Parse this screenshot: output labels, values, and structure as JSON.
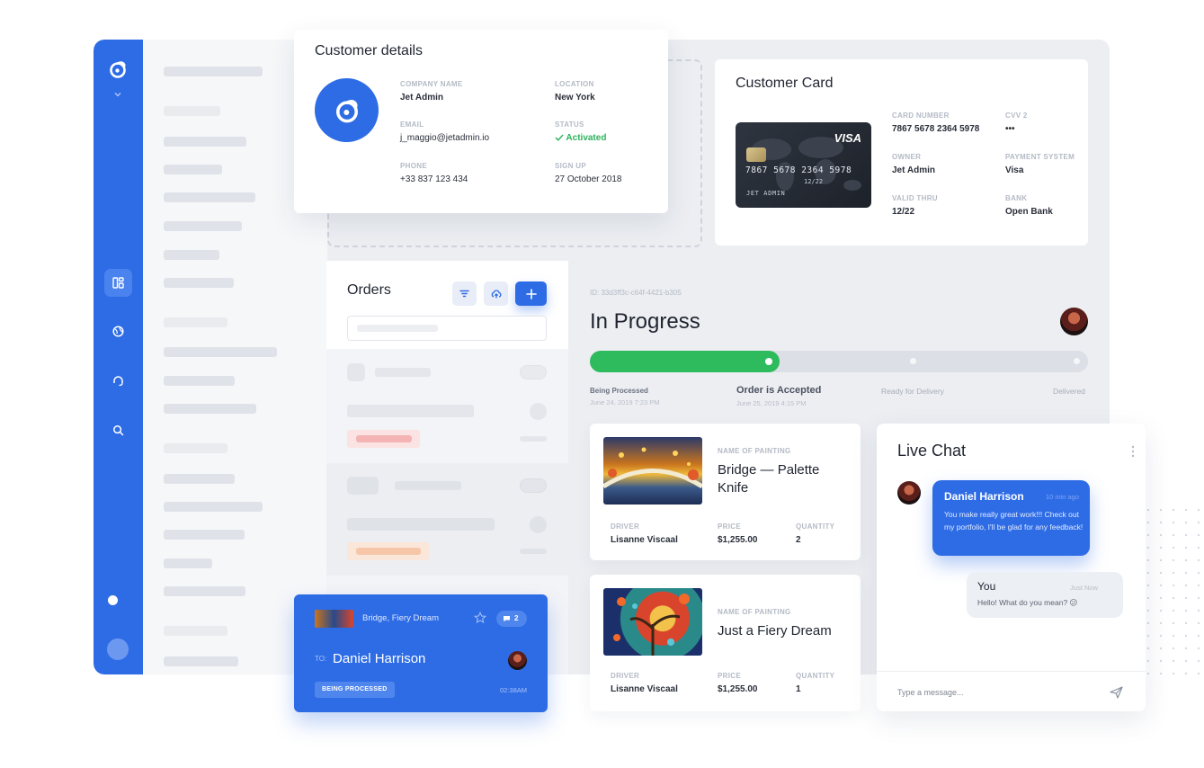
{
  "customer_details": {
    "title": "Customer details",
    "company_label": "COMPANY NAME",
    "company": "Jet Admin",
    "location_label": "LOCATION",
    "location": "New York",
    "email_label": "EMAIL",
    "email": "j_maggio@jetadmin.io",
    "status_label": "STATUS",
    "status": "Activated",
    "phone_label": "PHONE",
    "phone": "+33 837 123 434",
    "signup_label": "SIGN UP",
    "signup": "27 October 2018"
  },
  "customer_card": {
    "title": "Customer Card",
    "card_brand": "VISA",
    "card_face_number": "7867 5678 2364 5978",
    "card_face_expiry": "12/22",
    "card_face_holder": "JET ADMIN",
    "number_label": "CARD NUMBER",
    "number": "7867 5678 2364 5978",
    "cvv_label": "CVV 2",
    "cvv": "•••",
    "owner_label": "OWNER",
    "owner": "Jet Admin",
    "system_label": "PAYMENT SYSTEM",
    "system": "Visa",
    "valid_label": "VALID THRU",
    "valid": "12/22",
    "bank_label": "BANK",
    "bank": "Open Bank"
  },
  "orders": {
    "title": "Orders"
  },
  "progress": {
    "order_id": "ID: 33d3ff3c-c64f-4421-b305",
    "title": "In Progress",
    "fraction": 0.38,
    "steps": [
      {
        "label": "Being Processed",
        "date": "June 24, 2019 7:23 PM"
      },
      {
        "label": "Order is Accepted",
        "date": "June 25, 2019 4:15 PM"
      },
      {
        "label": "Ready for Delivery",
        "date": ""
      },
      {
        "label": "Delivered",
        "date": ""
      }
    ]
  },
  "paintings": [
    {
      "name_label": "NAME OF PAINTING",
      "name": "Bridge — Palette Knife",
      "driver_label": "DRIVER",
      "driver": "Lisanne Viscaal",
      "price_label": "PRICE",
      "price": "$1,255.00",
      "qty_label": "QUANTITY",
      "qty": "2"
    },
    {
      "name_label": "NAME OF PAINTING",
      "name": "Just a Fiery Dream",
      "driver_label": "DRIVER",
      "driver": "Lisanne Viscaal",
      "price_label": "PRICE",
      "price": "$1,255.00",
      "qty_label": "QUANTITY",
      "qty": "1"
    }
  ],
  "chat": {
    "title": "Live Chat",
    "incoming": {
      "name": "Daniel Harrison",
      "time": "10 min ago",
      "text": "You make really great work!!! Check out my portfolio, I'll be glad for any feedback!"
    },
    "outgoing": {
      "name": "You",
      "time": "Just Now",
      "text": "Hello! What do you mean?",
      "emoji": "😕"
    },
    "input_placeholder": "Type a message..."
  },
  "notification": {
    "painting": "Bridge, Fiery Dream",
    "comments": "2",
    "to_label": "TO:",
    "recipient": "Daniel Harrison",
    "status": "BEING PROCESSED",
    "time": "02:38AM"
  },
  "colors": {
    "accent": "#2e6ce6",
    "success": "#2dbb5d"
  }
}
